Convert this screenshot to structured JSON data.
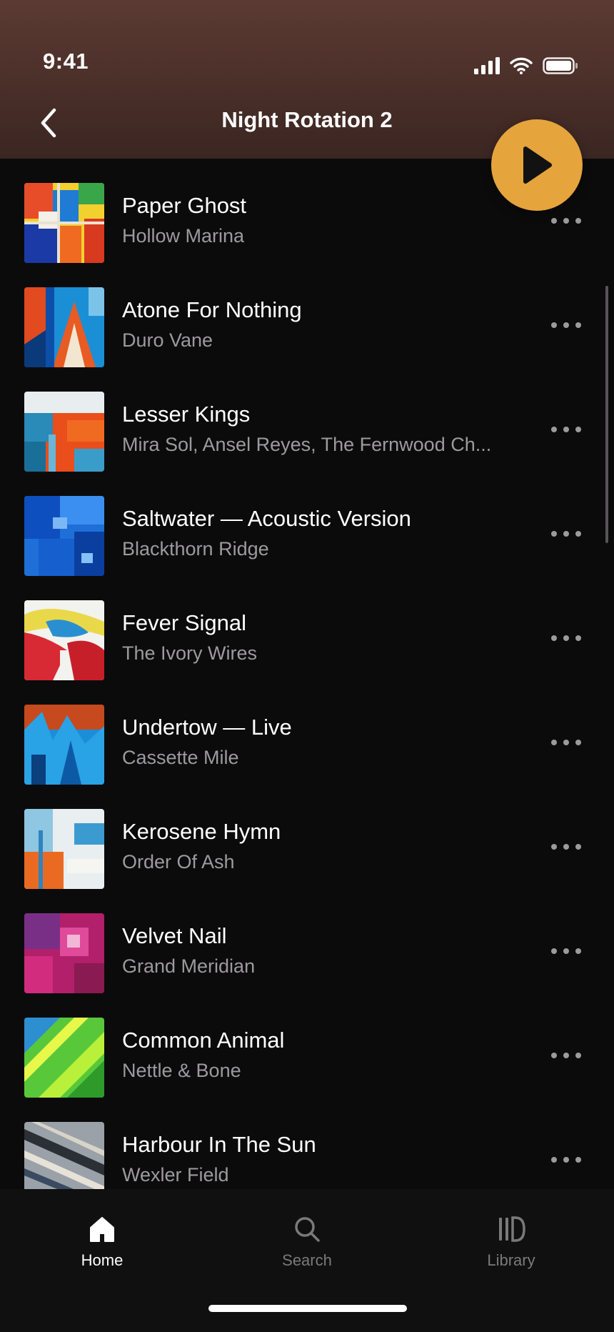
{
  "status_bar": {
    "time": "9:41"
  },
  "header": {
    "title": "Night Rotation 2"
  },
  "tracks": [
    {
      "title": "Paper Ghost",
      "artist": "Hollow Marina"
    },
    {
      "title": "Atone For Nothing",
      "artist": "Duro Vane"
    },
    {
      "title": "Lesser Kings",
      "artist": "Mira Sol, Ansel Reyes, The Fernwood Ch..."
    },
    {
      "title": "Saltwater — Acoustic Version",
      "artist": "Blackthorn Ridge"
    },
    {
      "title": "Fever Signal",
      "artist": "The Ivory Wires"
    },
    {
      "title": "Undertow — Live",
      "artist": "Cassette Mile"
    },
    {
      "title": "Kerosene Hymn",
      "artist": "Order Of Ash"
    },
    {
      "title": "Velvet Nail",
      "artist": "Grand Meridian"
    },
    {
      "title": "Common Animal",
      "artist": "Nettle & Bone"
    },
    {
      "title": "Harbour In The Sun",
      "artist": "Wexler Field"
    }
  ],
  "tabs": [
    {
      "label": "Home",
      "icon": "home-icon",
      "active": true
    },
    {
      "label": "Search",
      "icon": "search-icon",
      "active": false
    },
    {
      "label": "Library",
      "icon": "library-icon",
      "active": false
    }
  ],
  "colors": {
    "accent": "#e6a43c",
    "header": "#4a2f29",
    "background": "#0c0b0c",
    "secondary_text": "#9c9a9d"
  }
}
